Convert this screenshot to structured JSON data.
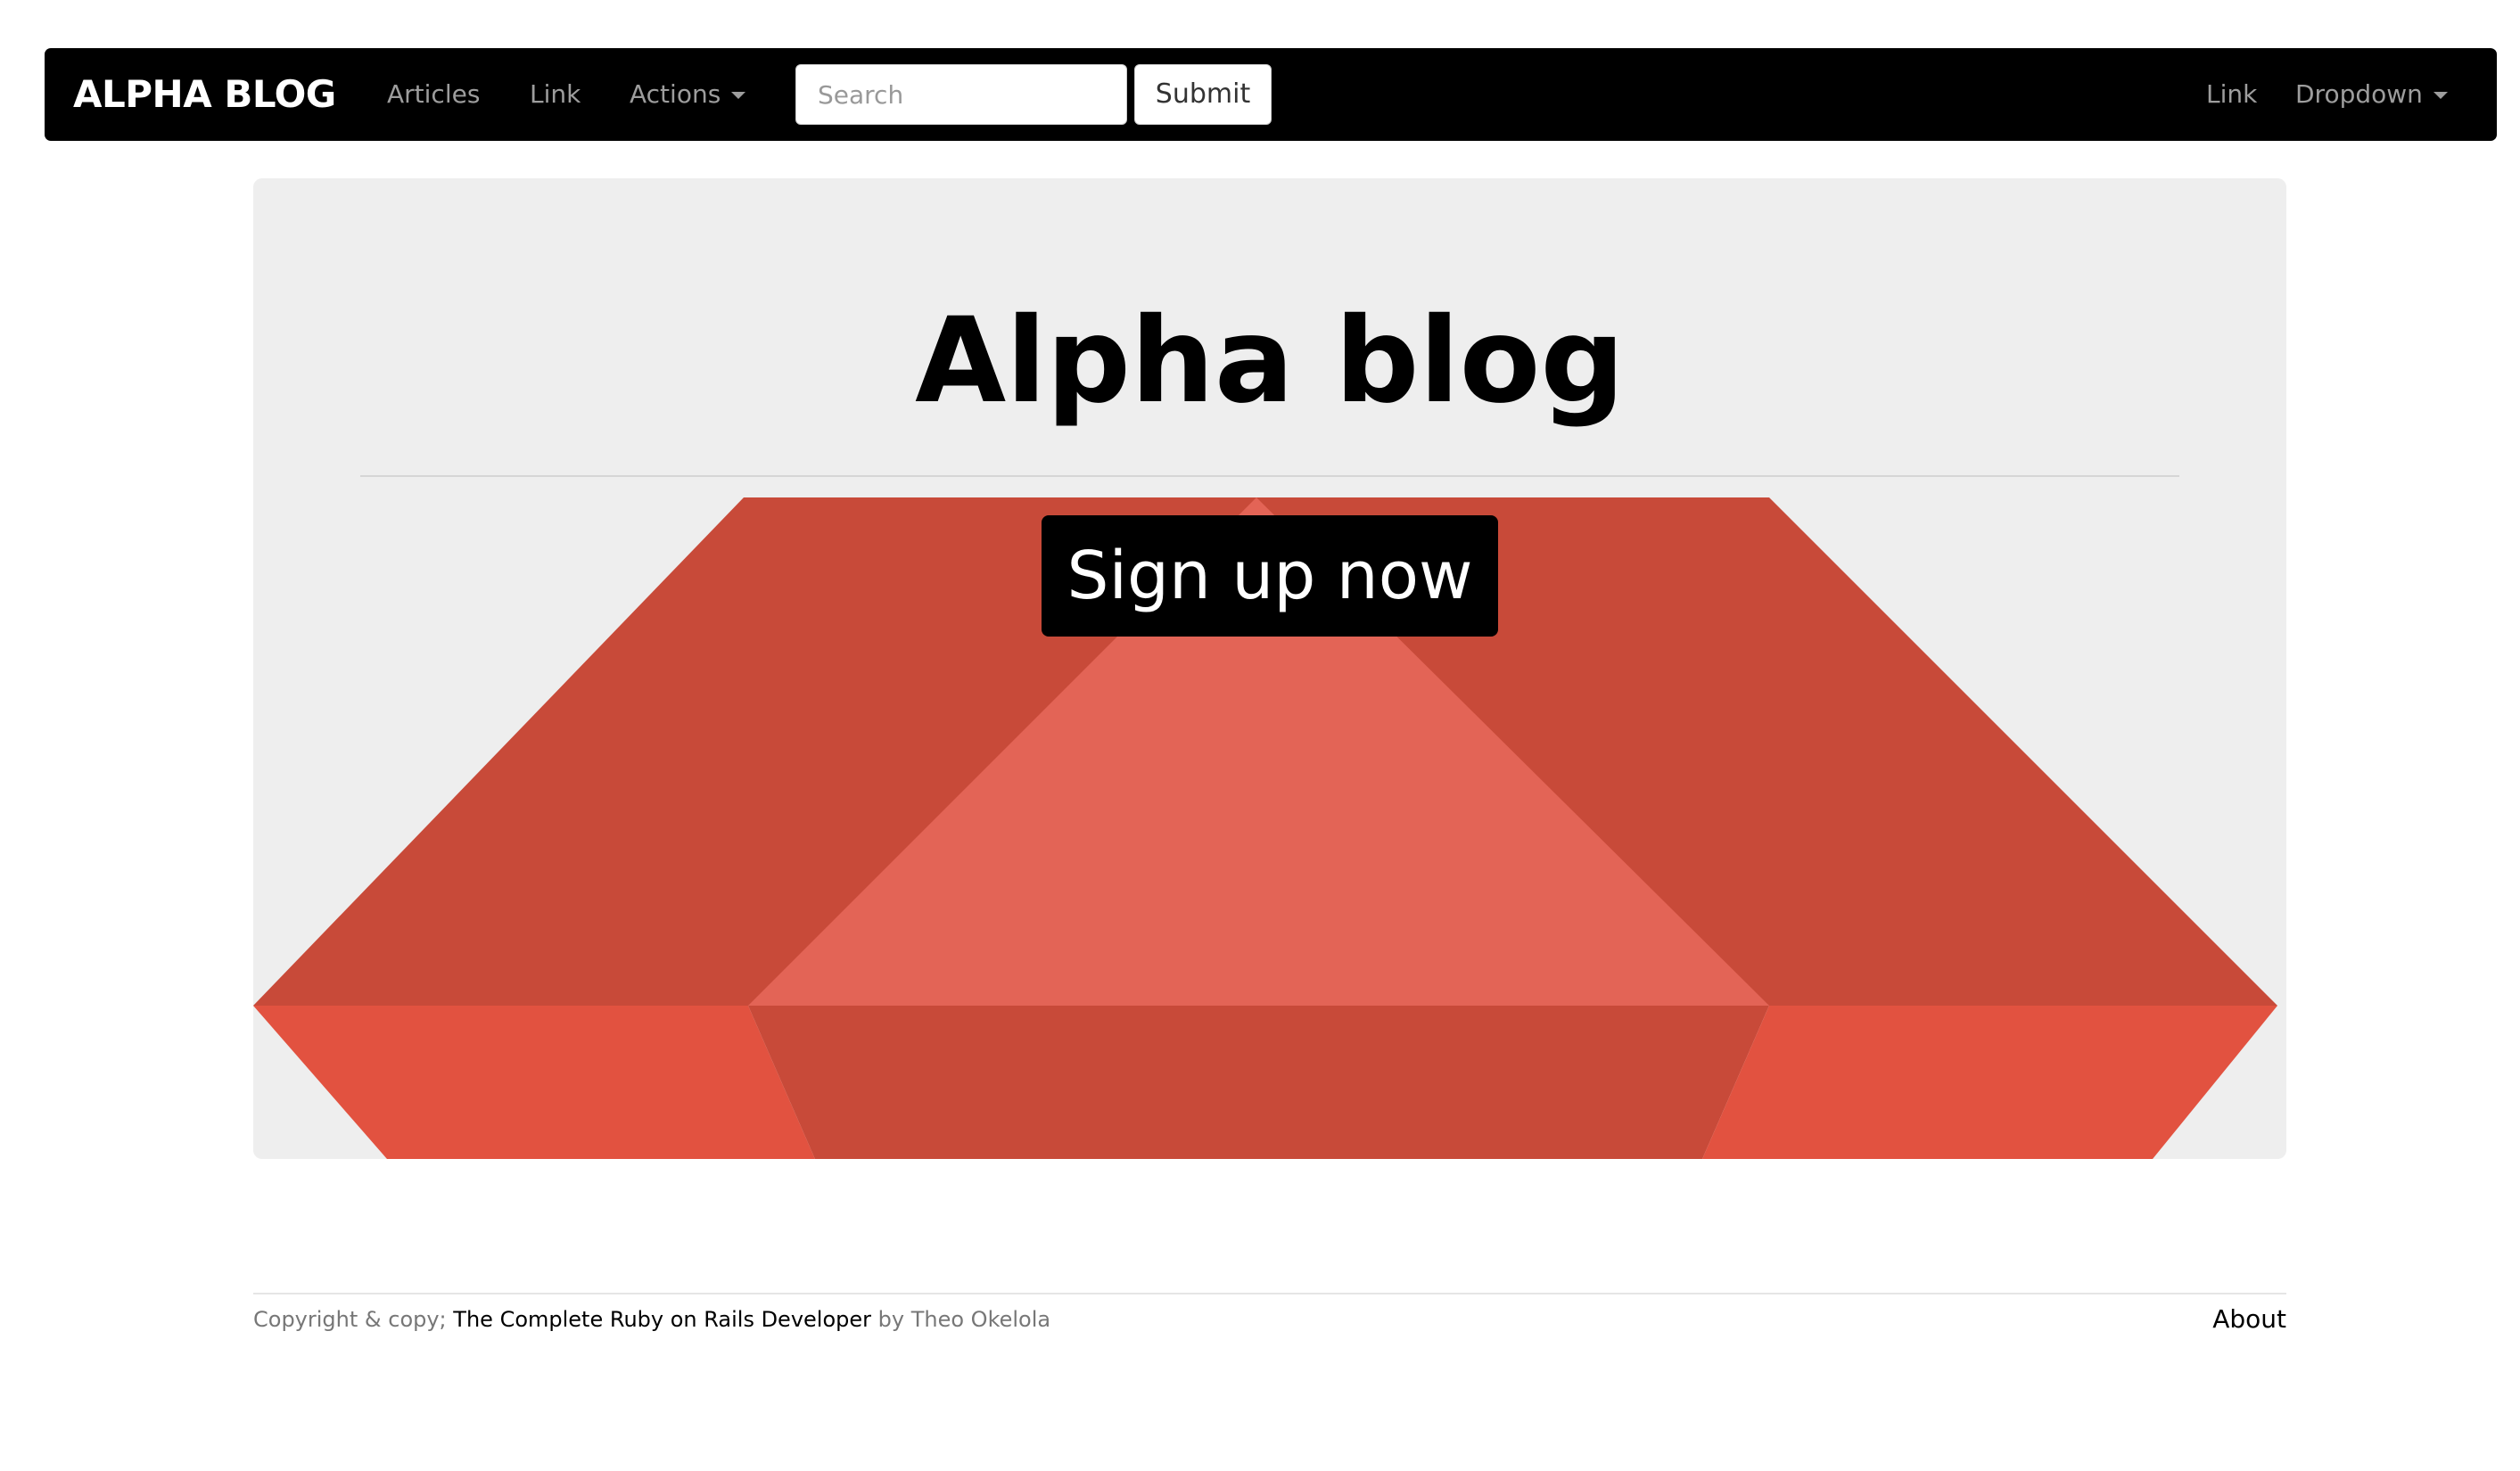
{
  "navbar": {
    "brand": "ALPHA BLOG",
    "links": {
      "articles": "Articles",
      "link": "Link",
      "actions": "Actions"
    },
    "search": {
      "placeholder": "Search",
      "value": ""
    },
    "submit_label": "Submit",
    "right_links": {
      "link": "Link",
      "dropdown": "Dropdown"
    }
  },
  "jumbotron": {
    "title": "Alpha blog",
    "signup_label": "Sign up now"
  },
  "footer": {
    "copyright_prefix": "Copyright & copy;",
    "course_link": "The Complete Ruby on Rails Developer",
    "author_text": "by Theo Okelola",
    "about_link": "About"
  },
  "colors": {
    "navbar_bg": "#000000",
    "nav_link": "#9d9d9d",
    "jumbotron_bg": "#eeeeee",
    "ruby_dark": "#c84a39",
    "ruby_light": "#e36456",
    "ruby_bright": "#e25240"
  },
  "icons": {
    "actions_dropdown": "caret-down-icon",
    "right_dropdown": "caret-down-icon",
    "background": "ruby-gem-image"
  }
}
